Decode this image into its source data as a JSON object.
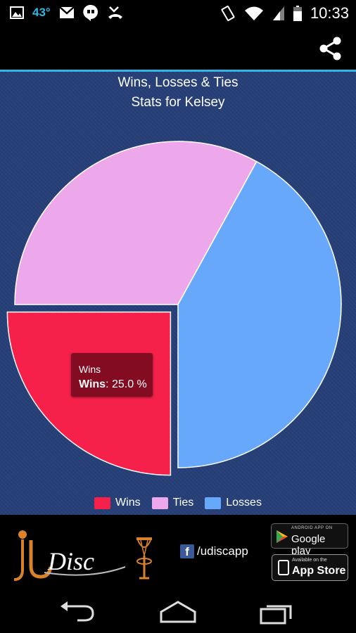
{
  "status_bar": {
    "temperature": "43°",
    "time": "10:33",
    "icons": [
      "image-icon",
      "gmail-icon",
      "hangouts-icon",
      "missed-call-icon",
      "vibrate-icon",
      "wifi-icon",
      "signal-icon",
      "battery-icon"
    ]
  },
  "action_bar": {
    "share_icon": "share-icon"
  },
  "chart_data": {
    "type": "pie",
    "title": "Wins, Losses & Ties",
    "subtitle": "Stats for Kelsey",
    "categories": [
      "Wins",
      "Ties",
      "Losses"
    ],
    "values": [
      25.0,
      33.0,
      42.0
    ],
    "colors": [
      "#f5214a",
      "#eda8ec",
      "#68a8fb"
    ],
    "exploded": "Wins",
    "legend": "bottom-center",
    "tooltip": {
      "title": "Wins",
      "label": "Wins",
      "value": "25.0 %"
    }
  },
  "banner": {
    "facebook": "/udiscapp",
    "google_play_small": "ANDROID APP ON",
    "google_play": "Google play",
    "app_store_small": "Available on the",
    "app_store": "App Store"
  },
  "nav_bar": {
    "icons": [
      "back-icon",
      "home-icon",
      "recents-icon"
    ]
  }
}
